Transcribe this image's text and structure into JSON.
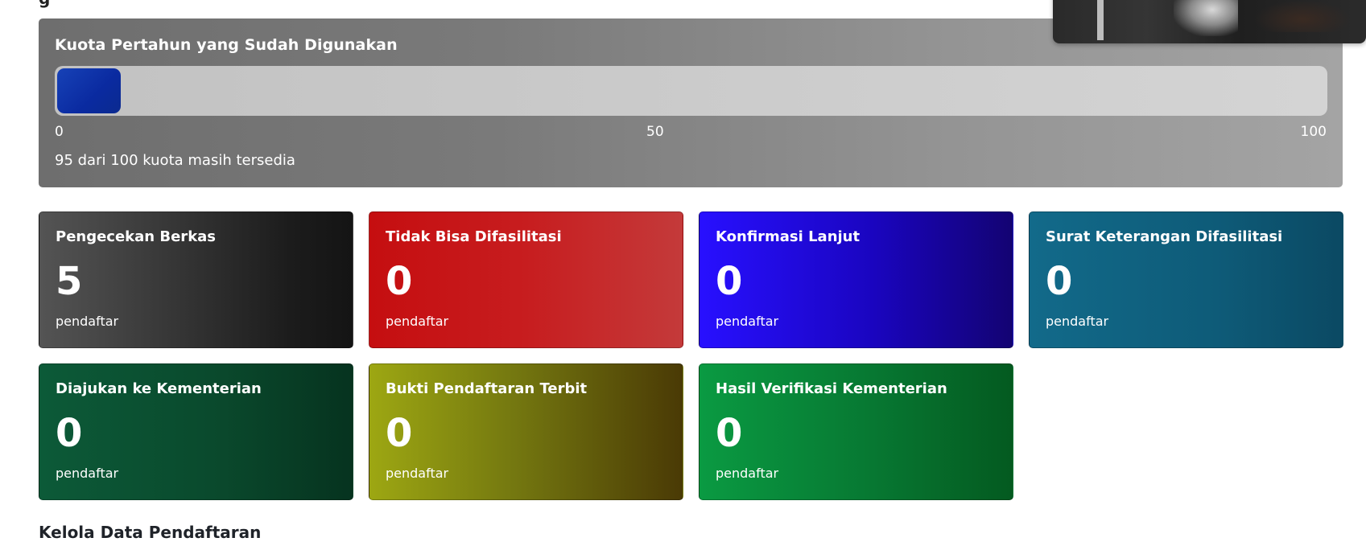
{
  "header": {
    "cut_text": "g"
  },
  "quota": {
    "title": "Kuota Pertahun yang Sudah Digunakan",
    "used": 5,
    "max": 100,
    "scale": [
      "0",
      "50",
      "100"
    ],
    "note": "95 dari 100 kuota masih tersedia",
    "fill_color": "#0a2aa0"
  },
  "cards": [
    {
      "title": "Pengecekan Berkas",
      "value": "5",
      "unit": "pendaftar",
      "color": "#1c1c1c"
    },
    {
      "title": "Tidak Bisa Difasilitasi",
      "value": "0",
      "unit": "pendaftar",
      "color": "#c71d1f"
    },
    {
      "title": "Konfirmasi Lanjut",
      "value": "0",
      "unit": "pendaftar",
      "color": "#1a05c0"
    },
    {
      "title": "Surat Keterangan Difasilitasi",
      "value": "0",
      "unit": "pendaftar",
      "color": "#0e5b78"
    },
    {
      "title": "Diajukan ke Kementerian",
      "value": "0",
      "unit": "pendaftar",
      "color": "#0a4a2d"
    },
    {
      "title": "Bukti Pendaftaran Terbit",
      "value": "0",
      "unit": "pendaftar",
      "color": "#757910"
    },
    {
      "title": "Hasil Verifikasi Kementerian",
      "value": "0",
      "unit": "pendaftar",
      "color": "#077832"
    }
  ],
  "section": {
    "heading": "Kelola Data Pendaftaran"
  },
  "overlay": {
    "icon": "video-preview-icon"
  }
}
